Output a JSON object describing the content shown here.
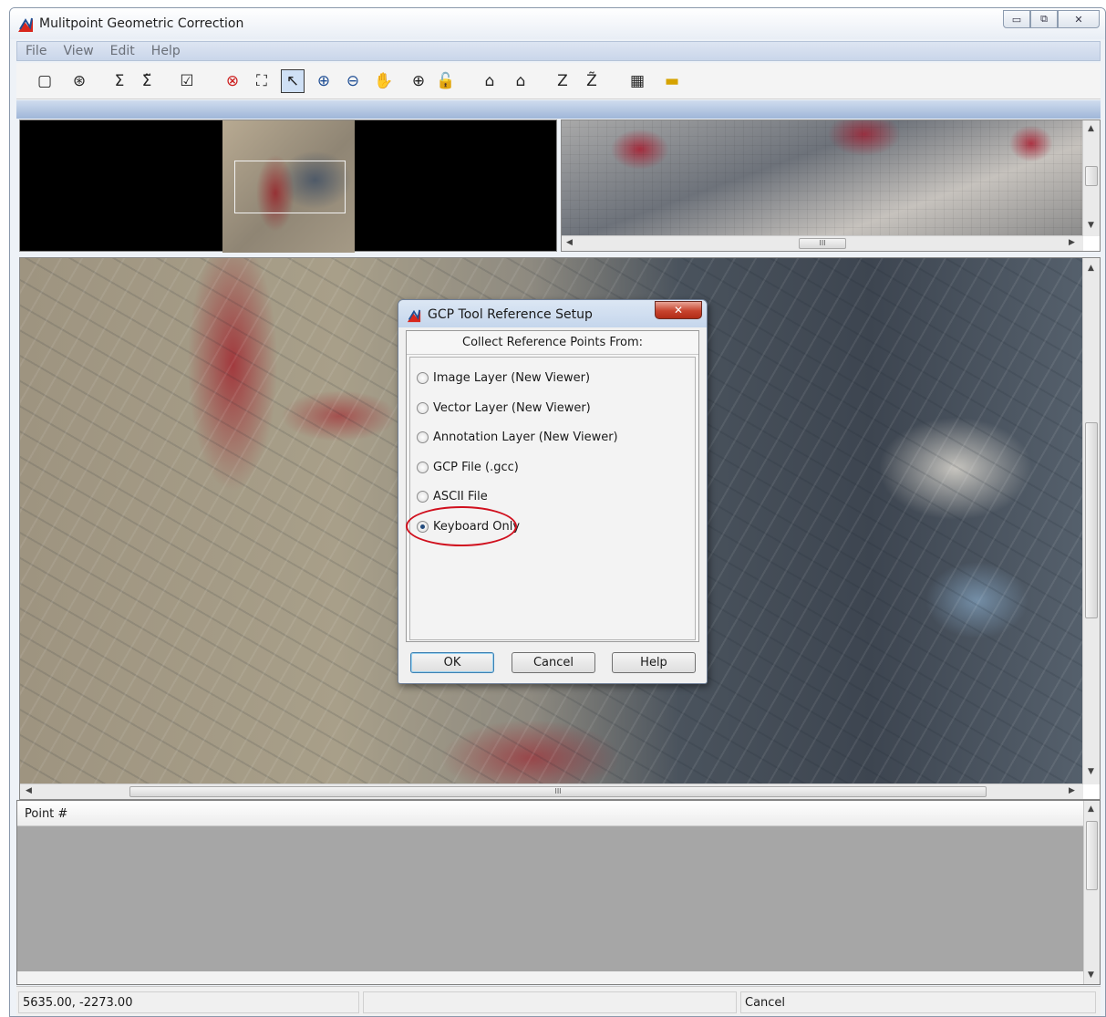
{
  "window": {
    "title": "Mulitpoint Geometric Correction",
    "minimize_glyph": "▭",
    "restore_glyph": "⧉",
    "close_glyph": "✕"
  },
  "menu": [
    "File",
    "View",
    "Edit",
    "Help"
  ],
  "toolbar": {
    "tools": [
      {
        "name": "table-view-icon",
        "glyph": "▢"
      },
      {
        "name": "model-properties-icon",
        "glyph": "⊛"
      },
      {
        "name": "sigma-icon",
        "glyph": "Σ"
      },
      {
        "name": "sigma-refresh-icon",
        "glyph": "Σ̃"
      },
      {
        "name": "check-icon",
        "glyph": "☑"
      },
      {
        "name": "reset-icon",
        "glyph": "⊗"
      },
      {
        "name": "fit-extent-icon",
        "glyph": "⛶"
      },
      {
        "name": "select-arrow-icon",
        "glyph": "↖"
      },
      {
        "name": "zoom-in-icon",
        "glyph": "⊕"
      },
      {
        "name": "zoom-out-icon",
        "glyph": "⊖"
      },
      {
        "name": "pan-hand-icon",
        "glyph": "✋"
      },
      {
        "name": "create-gcp-icon",
        "glyph": "⊕"
      },
      {
        "name": "lock-icon",
        "glyph": "🔓"
      },
      {
        "name": "binoculars-icon",
        "glyph": "⌂"
      },
      {
        "name": "binoculars-add-icon",
        "glyph": "⌂"
      },
      {
        "name": "z-value-icon",
        "glyph": "Z"
      },
      {
        "name": "z-refresh-icon",
        "glyph": "Z̃"
      },
      {
        "name": "layout-icon",
        "glyph": "▦"
      },
      {
        "name": "ruler-icon",
        "glyph": "▬"
      }
    ]
  },
  "scroll": {
    "thumb_grip": "III"
  },
  "dialog": {
    "title": "GCP Tool Reference Setup",
    "close_glyph": "✕",
    "heading": "Collect Reference Points From:",
    "options": [
      {
        "label": "Image Layer (New Viewer)",
        "checked": false
      },
      {
        "label": "Vector Layer (New Viewer)",
        "checked": false
      },
      {
        "label": "Annotation Layer (New Viewer)",
        "checked": false
      },
      {
        "label": "GCP File (.gcc)",
        "checked": false
      },
      {
        "label": "ASCII File",
        "checked": false
      },
      {
        "label": "Keyboard Only",
        "checked": true
      }
    ],
    "buttons": {
      "ok": "OK",
      "cancel": "Cancel",
      "help": "Help"
    },
    "highlight_color": "#d0101e"
  },
  "cellarray": {
    "column_header": "Point #"
  },
  "status": {
    "coordinates": "5635.00, -2273.00",
    "middle": "",
    "right": "Cancel"
  }
}
